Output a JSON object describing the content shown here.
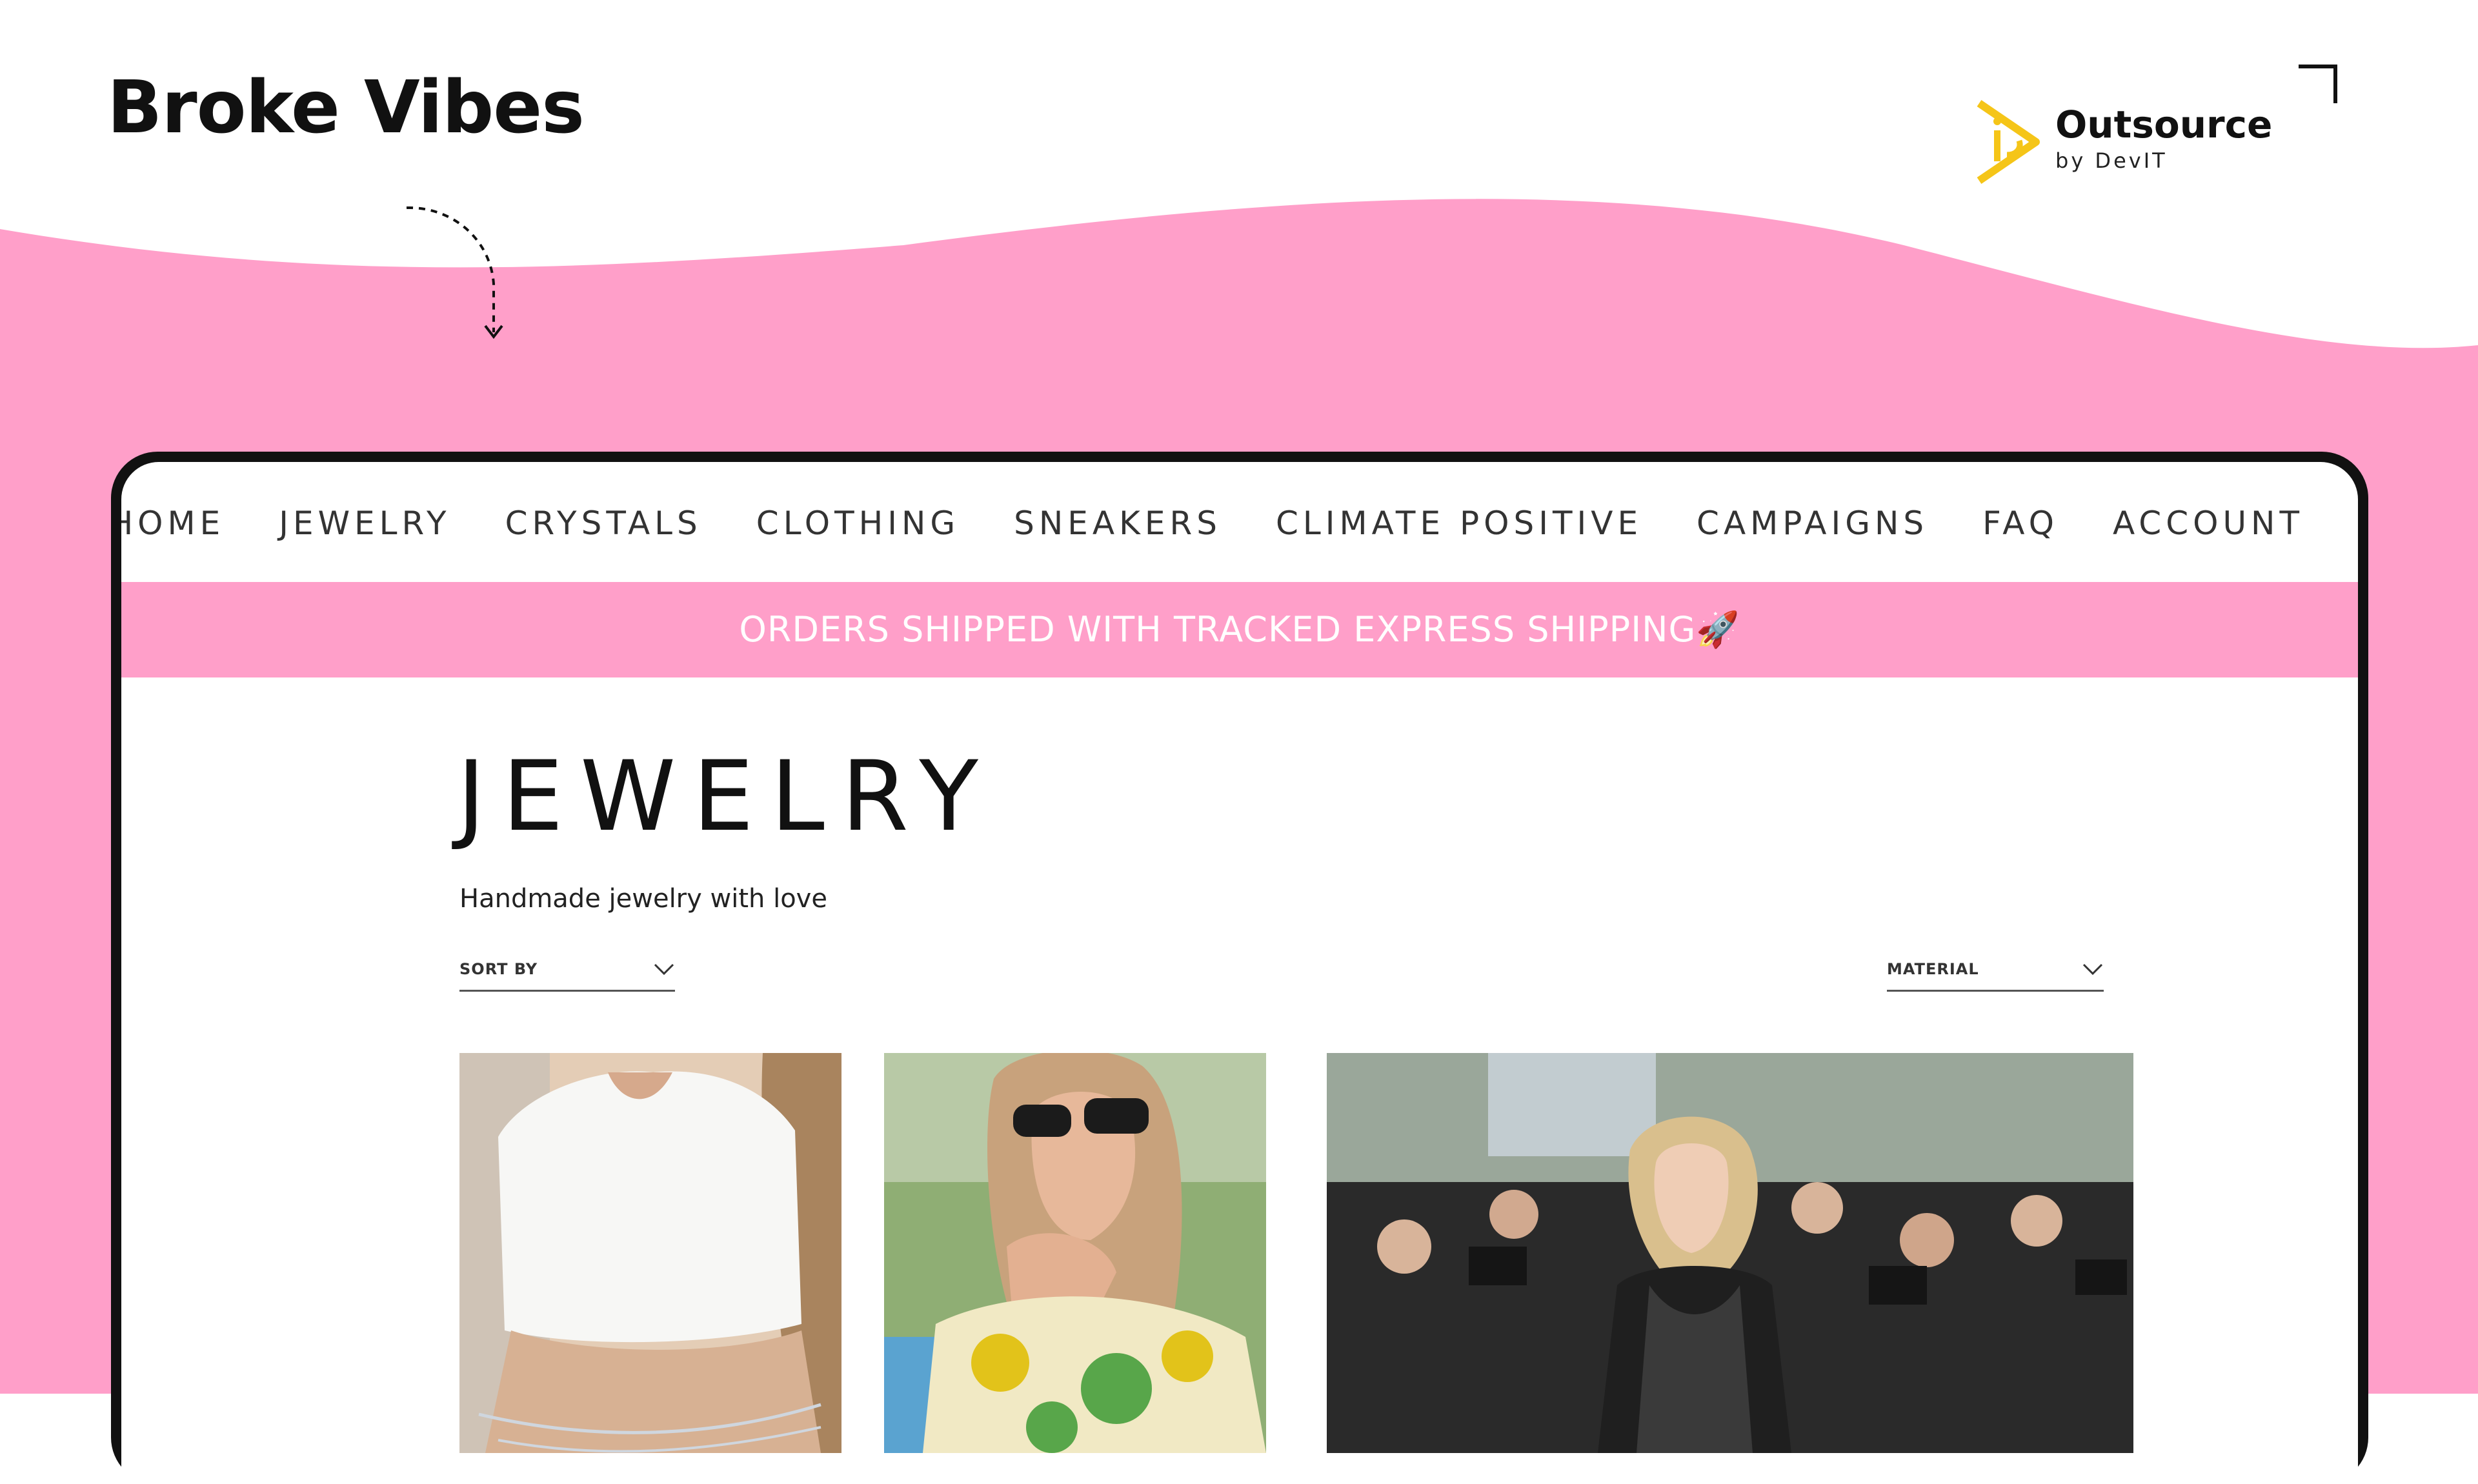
{
  "brand": {
    "title": "Broke Vibes",
    "accent_color": "#ff9fc9"
  },
  "logo": {
    "name": "Outsource",
    "tagline": "by DevIT",
    "mark_color": "#f5c518"
  },
  "site": {
    "nav": {
      "items": [
        "HOME",
        "JEWELRY",
        "CRYSTALS",
        "CLOTHING",
        "SNEAKERS",
        "CLIMATE POSITIVE",
        "CAMPAIGNS",
        "FAQ",
        "ACCOUNT"
      ]
    },
    "promo": {
      "text": "ORDERS SHIPPED WITH TRACKED EXPRESS SHIPPING🚀"
    },
    "page": {
      "heading": "JEWELRY",
      "subtitle": "Handmade jewelry  with love"
    },
    "filters": {
      "sort_label": "SORT BY",
      "material_label": "MATERIAL"
    }
  },
  "icons": [
    "dashed-arrow-icon",
    "outsource-logo-icon",
    "corner-bracket-icon",
    "chevron-down-icon"
  ]
}
